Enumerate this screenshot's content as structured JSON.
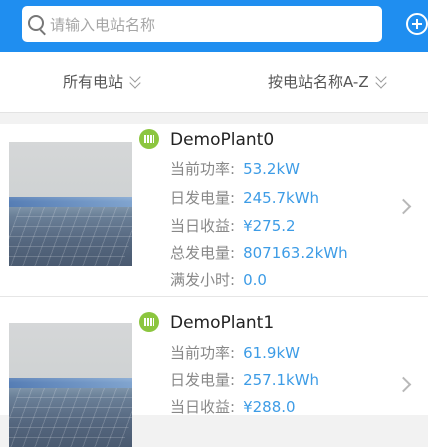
{
  "search": {
    "placeholder": "请输入电站名称"
  },
  "filters": {
    "all_label": "所有电站",
    "sort_label": "按电站名称A-Z"
  },
  "labels": {
    "power": "当前功率:",
    "daily_gen": "日发电量:",
    "daily_income": "当日收益:",
    "total_gen": "总发电量:",
    "full_hours": "满发小时:"
  },
  "plants": [
    {
      "name": "DemoPlant0",
      "power": "53.2kW",
      "daily_gen": "245.7kWh",
      "daily_income": "¥275.2",
      "total_gen": "807163.2kWh",
      "full_hours": "0.0"
    },
    {
      "name": "DemoPlant1",
      "power": "61.9kW",
      "daily_gen": "257.1kWh",
      "daily_income": "¥288.0"
    }
  ],
  "colors": {
    "header": "#1f8ef0",
    "value": "#3d9ce6",
    "plant_icon": "#8cc63f"
  }
}
